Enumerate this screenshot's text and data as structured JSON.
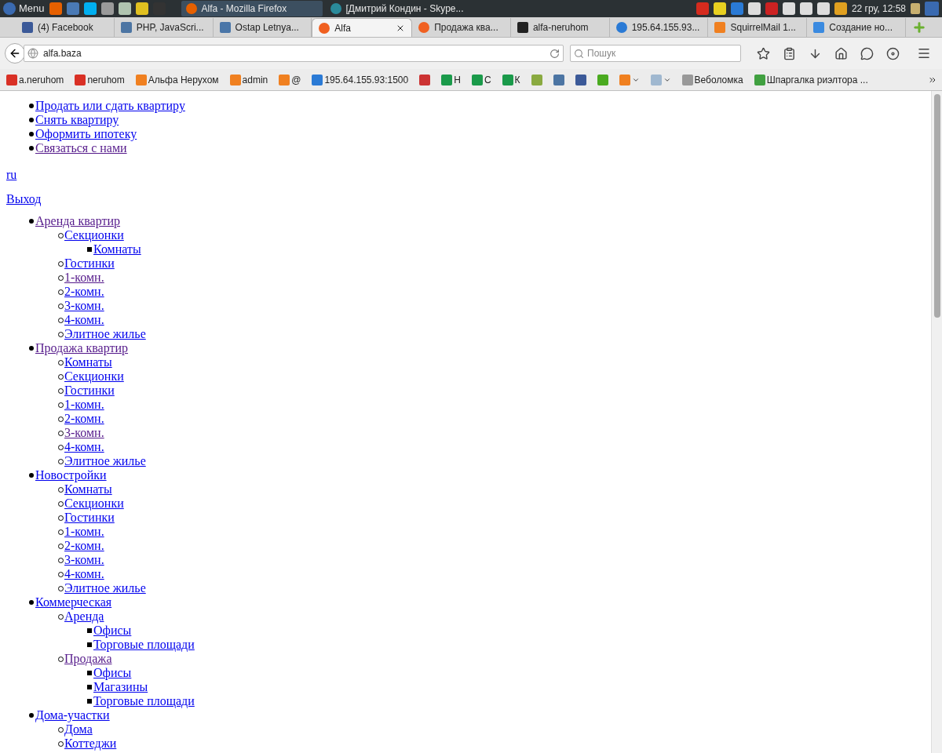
{
  "taskbar": {
    "menu_label": "Menu",
    "launchers": [
      {
        "color": "#e66000"
      },
      {
        "color": "#4a7ab5"
      },
      {
        "color": "#00aff0"
      },
      {
        "color": "#9a9a9a"
      },
      {
        "color": "#b0c4b0"
      },
      {
        "color": "#e0c020"
      },
      {
        "color": "#333333"
      }
    ],
    "windows": [
      {
        "title": "Alfa - Mozilla Firefox",
        "selected": true,
        "color": "#e66000"
      },
      {
        "title": "[Дмитрий Кондин - Skype...",
        "selected": false,
        "color": "#2a8a9a"
      }
    ],
    "tray": [
      {
        "color": "#d52b1e"
      },
      {
        "color": "#e8d020"
      },
      {
        "color": "#2a7ad5"
      },
      {
        "color": "#dddddd"
      },
      {
        "color": "#cc2222"
      },
      {
        "color": "#dddddd"
      },
      {
        "color": "#dddddd"
      },
      {
        "color": "#dddddd"
      },
      {
        "color": "#e0a020"
      }
    ],
    "clock": "22 гру, 12:58"
  },
  "tabs": [
    {
      "label": "(4) Facebook",
      "selected": false,
      "color": "#3b5998"
    },
    {
      "label": "PHP, JavaScri...",
      "selected": false,
      "color": "#4c75a3"
    },
    {
      "label": "Ostap Letnya...",
      "selected": false,
      "color": "#4a76a8"
    },
    {
      "label": "Alfa",
      "selected": true,
      "color": "#f06020"
    },
    {
      "label": "Продажа ква...",
      "selected": false,
      "color": "#f06020"
    },
    {
      "label": "alfa-neruhom",
      "selected": false,
      "color": "#222222"
    },
    {
      "label": "195.64.155.93...",
      "selected": false,
      "color": "#2a7ad5"
    },
    {
      "label": "SquirrelMail 1...",
      "selected": false,
      "color": "#f08020"
    },
    {
      "label": "Создание но...",
      "selected": false,
      "color": "#3a8ae0"
    }
  ],
  "address": {
    "value": "alfa.baza"
  },
  "search": {
    "placeholder": "Пошук"
  },
  "bookmarks": [
    {
      "label": "a.neruhom",
      "color": "#d93025"
    },
    {
      "label": "neruhom",
      "color": "#d93025"
    },
    {
      "label": "Альфа Нерухом",
      "color": "#f08020"
    },
    {
      "label": "admin",
      "color": "#f08020"
    },
    {
      "label": "@",
      "color": "#f08020"
    },
    {
      "label": "195.64.155.93:1500",
      "color": "#2a7ad5"
    },
    {
      "color": "#cc3333"
    },
    {
      "label": "Н",
      "color": "#1a9a4a"
    },
    {
      "label": "С",
      "color": "#1a9a4a"
    },
    {
      "label": "К",
      "color": "#1a9a4a"
    },
    {
      "color": "#8aaa40"
    },
    {
      "color": "#4c75a3"
    },
    {
      "color": "#3b5998"
    },
    {
      "color": "#4aaa20"
    },
    {
      "color": "#f08020",
      "dropdown": true
    },
    {
      "color": "#a0b8d0",
      "dropdown": true
    },
    {
      "label": "Веболомка",
      "color": "#999999"
    },
    {
      "label": "Шпаргалка риэлтора ...",
      "color": "#40a040"
    }
  ],
  "top_menu": [
    {
      "label": "Продать или сдать квартиру",
      "visited": false
    },
    {
      "label": "Снять квартиру",
      "visited": false
    },
    {
      "label": "Оформить ипотеку",
      "visited": false
    },
    {
      "label": "Связаться с нами",
      "visited": true
    }
  ],
  "language_link": "ru",
  "logout_link": "Выход",
  "catalog": [
    {
      "label": "Аренда квартир",
      "visited": true,
      "children": [
        {
          "label": "Секционки",
          "visited": false,
          "children": [
            {
              "label": "Комнаты",
              "visited": false
            }
          ]
        },
        {
          "label": "Гостинки",
          "visited": false
        },
        {
          "label": "1-комн.",
          "visited": true
        },
        {
          "label": "2-комн.",
          "visited": false
        },
        {
          "label": "3-комн.",
          "visited": false
        },
        {
          "label": "4-комн.",
          "visited": false
        },
        {
          "label": "Элитное жилье",
          "visited": false
        }
      ]
    },
    {
      "label": "Продажа квартир",
      "visited": true,
      "children": [
        {
          "label": "Комнаты",
          "visited": false
        },
        {
          "label": "Секционки",
          "visited": false
        },
        {
          "label": "Гостинки",
          "visited": false
        },
        {
          "label": "1-комн.",
          "visited": false
        },
        {
          "label": "2-комн.",
          "visited": false
        },
        {
          "label": "3-комн.",
          "visited": true
        },
        {
          "label": "4-комн.",
          "visited": false
        },
        {
          "label": "Элитное жилье",
          "visited": false
        }
      ]
    },
    {
      "label": "Новостройки",
      "visited": false,
      "children": [
        {
          "label": "Комнаты",
          "visited": false
        },
        {
          "label": "Секционки",
          "visited": false
        },
        {
          "label": "Гостинки",
          "visited": false
        },
        {
          "label": "1-комн.",
          "visited": false
        },
        {
          "label": "2-комн.",
          "visited": false
        },
        {
          "label": "3-комн.",
          "visited": false
        },
        {
          "label": "4-комн.",
          "visited": false
        },
        {
          "label": "Элитное жилье",
          "visited": false
        }
      ]
    },
    {
      "label": "Коммерческая",
      "visited": false,
      "children": [
        {
          "label": "Аренда",
          "visited": false,
          "children": [
            {
              "label": "Офисы",
              "visited": false
            },
            {
              "label": "Торговые площади",
              "visited": false
            }
          ]
        },
        {
          "label": "Продажа",
          "visited": true,
          "children": [
            {
              "label": "Офисы",
              "visited": false
            },
            {
              "label": "Магазины",
              "visited": false
            },
            {
              "label": "Торговые площади",
              "visited": false
            }
          ]
        }
      ]
    },
    {
      "label": "Дома-участки",
      "visited": false,
      "children": [
        {
          "label": "Дома",
          "visited": false
        },
        {
          "label": "Коттеджи",
          "visited": false
        }
      ]
    }
  ]
}
